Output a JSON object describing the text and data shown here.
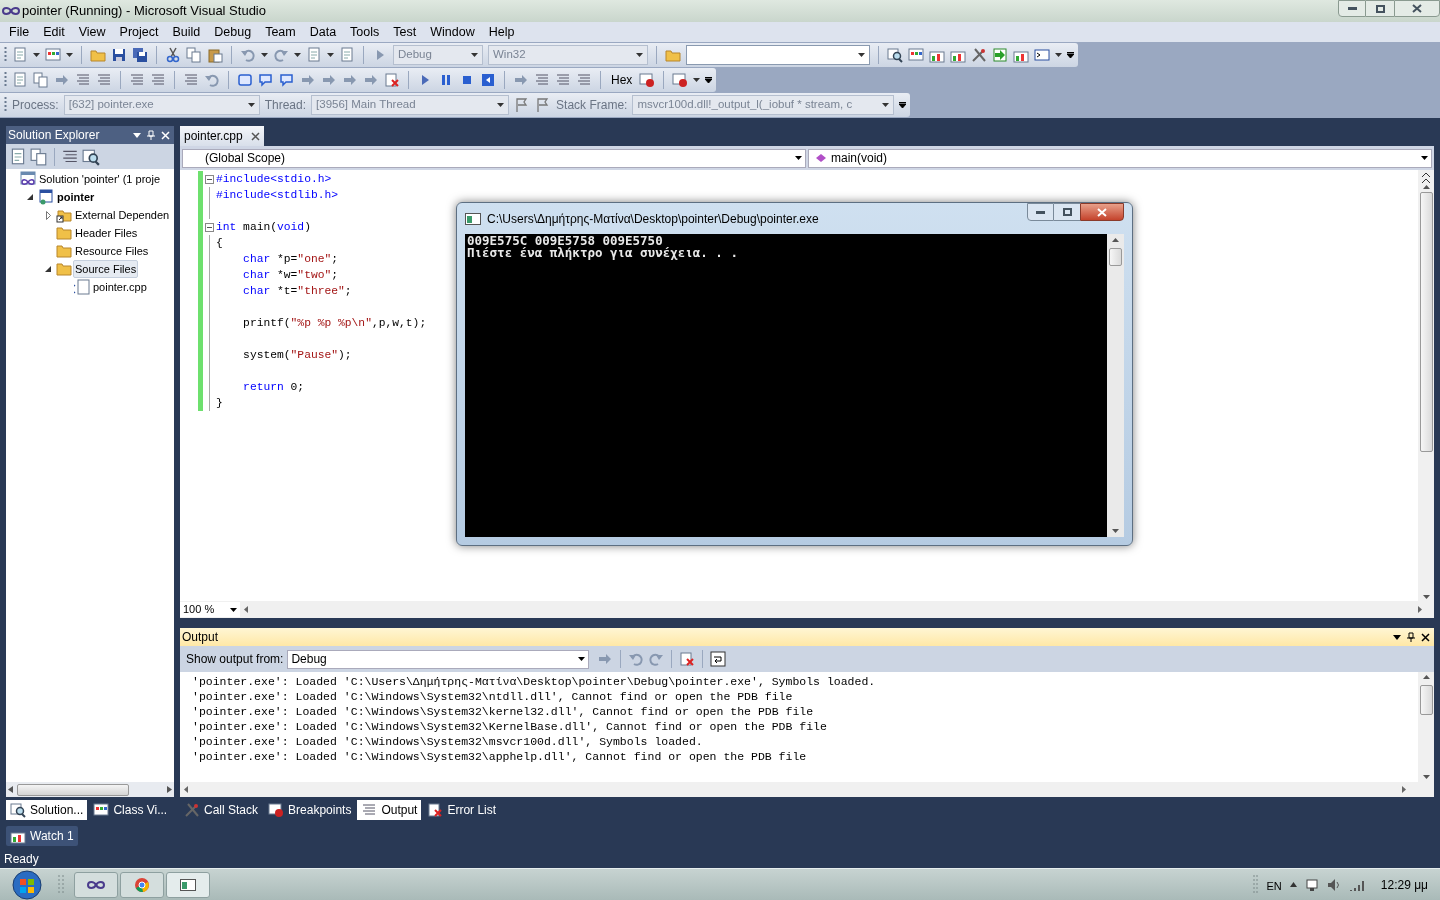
{
  "window": {
    "title": "pointer (Running) - Microsoft Visual Studio"
  },
  "menu": [
    "File",
    "Edit",
    "View",
    "Project",
    "Build",
    "Debug",
    "Team",
    "Data",
    "Tools",
    "Test",
    "Window",
    "Help"
  ],
  "toolbars": [
    {
      "items": [
        {
          "kind": "combo",
          "value": "Debug",
          "disabled": true
        },
        {
          "kind": "combo",
          "value": "Win32",
          "disabled": true
        },
        {
          "kind": "combo",
          "disabled": false
        }
      ]
    },
    {
      "items": [
        {
          "kind": "button",
          "label": "Hex"
        }
      ]
    },
    {
      "items": [
        {
          "kind": "label",
          "label": "Process:"
        },
        {
          "kind": "combo",
          "value": "[632] pointer.exe",
          "disabled": true
        },
        {
          "kind": "label",
          "label": "Thread:"
        },
        {
          "kind": "combo",
          "value": "[3956] Main Thread",
          "disabled": true
        },
        {
          "kind": "label",
          "label": "Stack Frame:"
        },
        {
          "kind": "combo",
          "value": "msvcr100d.dll!_output_l(_iobuf * stream, c",
          "disabled": true
        }
      ]
    }
  ],
  "solution_explorer": {
    "title": "Solution Explorer",
    "tree": [
      {
        "label": "Solution 'pointer' (1 proje",
        "kind": "solution",
        "expander": false,
        "selected": false,
        "children": [
          {
            "label": "pointer",
            "kind": "project",
            "expander": true,
            "expanded": true,
            "selected": false,
            "children": [
              {
                "label": "External Dependen",
                "kind": "reference-folder",
                "expander": true,
                "expanded": false,
                "selected": false
              },
              {
                "label": "Header Files",
                "kind": "folder",
                "expander": false,
                "selected": false
              },
              {
                "label": "Resource Files",
                "kind": "folder",
                "expander": false,
                "selected": false
              },
              {
                "label": "Source Files",
                "kind": "folder",
                "expander": true,
                "expanded": true,
                "selected": true,
                "children": [
                  {
                    "label": "pointer.cpp",
                    "kind": "file",
                    "expander": false,
                    "selected": false
                  }
                ]
              }
            ]
          }
        ]
      }
    ]
  },
  "editor": {
    "tabs": [
      {
        "label": "pointer.cpp",
        "selected": true
      }
    ],
    "scope": "(Global Scope)",
    "member": "main(void)",
    "zoom": "100 %",
    "lines": [
      {
        "kind": "code",
        "foldable": true,
        "segments": [
          {
            "t": "#include<stdio.h>",
            "kind": "preprocessor"
          }
        ]
      },
      {
        "kind": "code",
        "foldable": false,
        "segments": [
          {
            "t": "#include<stdlib.h>",
            "kind": "preprocessor"
          }
        ]
      },
      {
        "kind": "blank"
      },
      {
        "kind": "code",
        "foldable": true,
        "segments": [
          {
            "t": "int",
            "kind": "keyword"
          },
          {
            "t": " main(",
            "kind": "plain"
          },
          {
            "t": "void",
            "kind": "keyword"
          },
          {
            "t": ")",
            "kind": "plain"
          }
        ]
      },
      {
        "kind": "code",
        "foldable": false,
        "segments": [
          {
            "t": "{",
            "kind": "plain"
          }
        ]
      },
      {
        "kind": "code",
        "foldable": false,
        "segments": [
          {
            "t": "    char",
            "kind": "keyword"
          },
          {
            "t": " *p=",
            "kind": "plain"
          },
          {
            "t": "\"one\"",
            "kind": "string"
          },
          {
            "t": ";",
            "kind": "plain"
          }
        ]
      },
      {
        "kind": "code",
        "foldable": false,
        "segments": [
          {
            "t": "    char",
            "kind": "keyword"
          },
          {
            "t": " *w=",
            "kind": "plain"
          },
          {
            "t": "\"two\"",
            "kind": "string"
          },
          {
            "t": ";",
            "kind": "plain"
          }
        ]
      },
      {
        "kind": "code",
        "foldable": false,
        "segments": [
          {
            "t": "    char",
            "kind": "keyword"
          },
          {
            "t": " *t=",
            "kind": "plain"
          },
          {
            "t": "\"three\"",
            "kind": "string"
          },
          {
            "t": ";",
            "kind": "plain"
          }
        ]
      },
      {
        "kind": "blank"
      },
      {
        "kind": "code",
        "foldable": false,
        "segments": [
          {
            "t": "    printf(",
            "kind": "plain"
          },
          {
            "t": "\"%p %p %p\\n\"",
            "kind": "string"
          },
          {
            "t": ",p,w,t);",
            "kind": "plain"
          }
        ]
      },
      {
        "kind": "blank"
      },
      {
        "kind": "code",
        "foldable": false,
        "segments": [
          {
            "t": "    system(",
            "kind": "plain"
          },
          {
            "t": "\"Pause\"",
            "kind": "string"
          },
          {
            "t": ");",
            "kind": "plain"
          }
        ]
      },
      {
        "kind": "blank"
      },
      {
        "kind": "code",
        "foldable": false,
        "segments": [
          {
            "t": "    return",
            "kind": "keyword"
          },
          {
            "t": " 0;",
            "kind": "plain"
          }
        ]
      },
      {
        "kind": "code",
        "foldable": false,
        "segments": [
          {
            "t": "}",
            "kind": "plain"
          }
        ]
      }
    ]
  },
  "console": {
    "title": "C:\\Users\\Δημήτρης-Ματίνα\\Desktop\\pointer\\Debug\\pointer.exe",
    "lines": [
      "009E575C 009E5758 009E5750",
      "Πιέστε ένα πλήκτρο για συνέχεια. . ."
    ]
  },
  "output": {
    "title": "Output",
    "source_label": "Show output from:",
    "source": "Debug",
    "lines": [
      "'pointer.exe': Loaded 'C:\\Users\\Δημήτρης-Ματίνα\\Desktop\\pointer\\Debug\\pointer.exe', Symbols loaded.",
      "'pointer.exe': Loaded 'C:\\Windows\\System32\\ntdll.dll', Cannot find or open the PDB file",
      "'pointer.exe': Loaded 'C:\\Windows\\System32\\kernel32.dll', Cannot find or open the PDB file",
      "'pointer.exe': Loaded 'C:\\Windows\\System32\\KernelBase.dll', Cannot find or open the PDB file",
      "'pointer.exe': Loaded 'C:\\Windows\\System32\\msvcr100d.dll', Symbols loaded.",
      "'pointer.exe': Loaded 'C:\\Windows\\System32\\apphelp.dll', Cannot find or open the PDB file"
    ]
  },
  "left_tabs": [
    {
      "label": "Solution...",
      "selected": true
    },
    {
      "label": "Class Vi...",
      "selected": false
    }
  ],
  "bottom_tabs": [
    {
      "label": "Call Stack",
      "selected": false
    },
    {
      "label": "Breakpoints",
      "selected": false
    },
    {
      "label": "Output",
      "selected": true
    },
    {
      "label": "Error List",
      "selected": false
    }
  ],
  "watch_tabs": [
    "Watch 1"
  ],
  "status_bar": {
    "text": "Ready"
  },
  "taskbar": {
    "language": "EN",
    "clock": "12:29 μμ"
  }
}
